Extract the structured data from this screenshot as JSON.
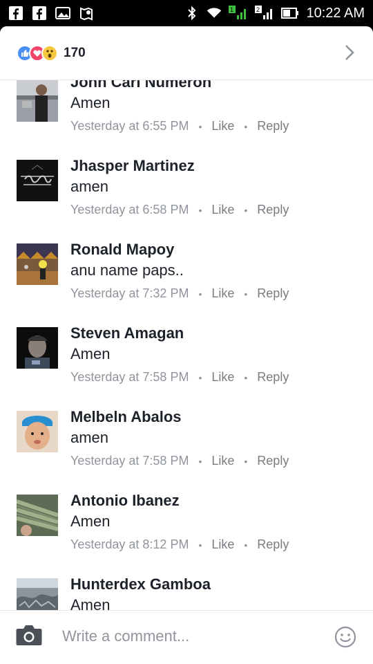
{
  "status_bar": {
    "time": "10:22 AM",
    "icons": [
      "facebook-icon",
      "facebook-icon",
      "gallery-icon",
      "location-icon",
      "bluetooth-icon",
      "wifi-icon",
      "signal-icon",
      "signal-icon",
      "battery-icon"
    ],
    "signal_badges": [
      "1",
      "2"
    ]
  },
  "reactions": {
    "types": [
      "like",
      "love",
      "wow"
    ],
    "count": "170"
  },
  "comments": [
    {
      "name": "John Carl Numeron",
      "text": "Amen",
      "time": "Yesterday at 6:55 PM",
      "like": "Like",
      "reply": "Reply"
    },
    {
      "name": "Jhasper Martinez",
      "text": "amen",
      "time": "Yesterday at 6:58 PM",
      "like": "Like",
      "reply": "Reply"
    },
    {
      "name": "Ronald Mapoy",
      "text": "anu name paps..",
      "time": "Yesterday at 7:32 PM",
      "like": "Like",
      "reply": "Reply"
    },
    {
      "name": "Steven Amagan",
      "text": "Amen",
      "time": "Yesterday at 7:58 PM",
      "like": "Like",
      "reply": "Reply"
    },
    {
      "name": "Melbeln Abalos",
      "text": "amen",
      "time": "Yesterday at 7:58 PM",
      "like": "Like",
      "reply": "Reply"
    },
    {
      "name": "Antonio Ibanez",
      "text": "Amen",
      "time": "Yesterday at 8:12 PM",
      "like": "Like",
      "reply": "Reply"
    },
    {
      "name": "Hunterdex Gamboa",
      "text": "Amen",
      "time": "",
      "like": "",
      "reply": ""
    }
  ],
  "composer": {
    "placeholder": "Write a comment..."
  },
  "colors": {
    "like": "#4a8ff5",
    "love": "#f0466a",
    "wow": "#f7c942",
    "text": "#1d2129",
    "meta": "#90949c"
  }
}
